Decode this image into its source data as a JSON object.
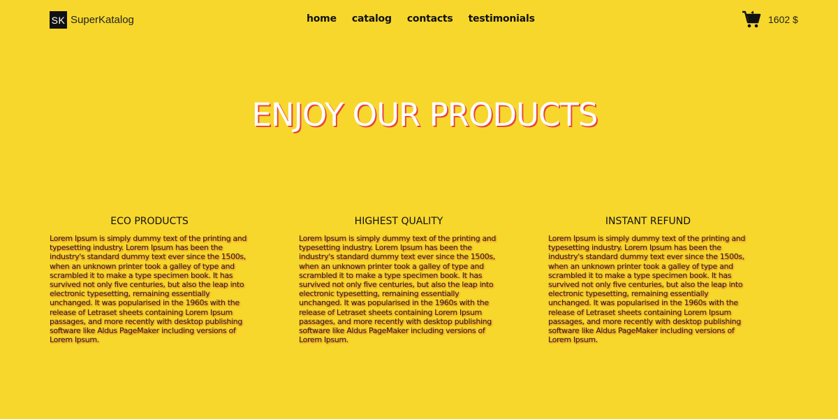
{
  "header": {
    "logo_mark": "SK",
    "logo_name": "SuperKatalog",
    "nav": [
      "home",
      "catalog",
      "contacts",
      "testimonials"
    ],
    "cart_icon": "shopping-cart-icon",
    "cart_total": "1602 $"
  },
  "hero": {
    "title": "ENJOY OUR PRODUCTS"
  },
  "features": [
    {
      "title": "ECO PRODUCTS",
      "text": "Lorem Ipsum is simply dummy text of the printing and typesetting industry. Lorem Ipsum has been the industry's standard dummy text ever since the 1500s, when an unknown printer took a galley of type and scrambled it to make a type specimen book. It has survived not only five centuries, but also the leap into electronic typesetting, remaining essentially unchanged. It was popularised in the 1960s with the release of Letraset sheets containing Lorem Ipsum passages, and more recently with desktop publishing software like Aldus PageMaker including versions of Lorem Ipsum."
    },
    {
      "title": "HIGHEST QUALITY",
      "text": "Lorem Ipsum is simply dummy text of the printing and typesetting industry. Lorem Ipsum has been the industry's standard dummy text ever since the 1500s, when an unknown printer took a galley of type and scrambled it to make a type specimen book. It has survived not only five centuries, but also the leap into electronic typesetting, remaining essentially unchanged. It was popularised in the 1960s with the release of Letraset sheets containing Lorem Ipsum passages, and more recently with desktop publishing software like Aldus PageMaker including versions of Lorem Ipsum."
    },
    {
      "title": "INSTANT REFUND",
      "text": "Lorem Ipsum is simply dummy text of the printing and typesetting industry. Lorem Ipsum has been the industry's standard dummy text ever since the 1500s, when an unknown printer took a galley of type and scrambled it to make a type specimen book. It has survived not only five centuries, but also the leap into electronic typesetting, remaining essentially unchanged. It was popularised in the 1960s with the release of Letraset sheets containing Lorem Ipsum passages, and more recently with desktop publishing software like Aldus PageMaker including versions of Lorem Ipsum."
    }
  ],
  "colors": {
    "background": "#f7d72c",
    "title_shadow": "#e8453a",
    "text_glow": "#f05020"
  }
}
